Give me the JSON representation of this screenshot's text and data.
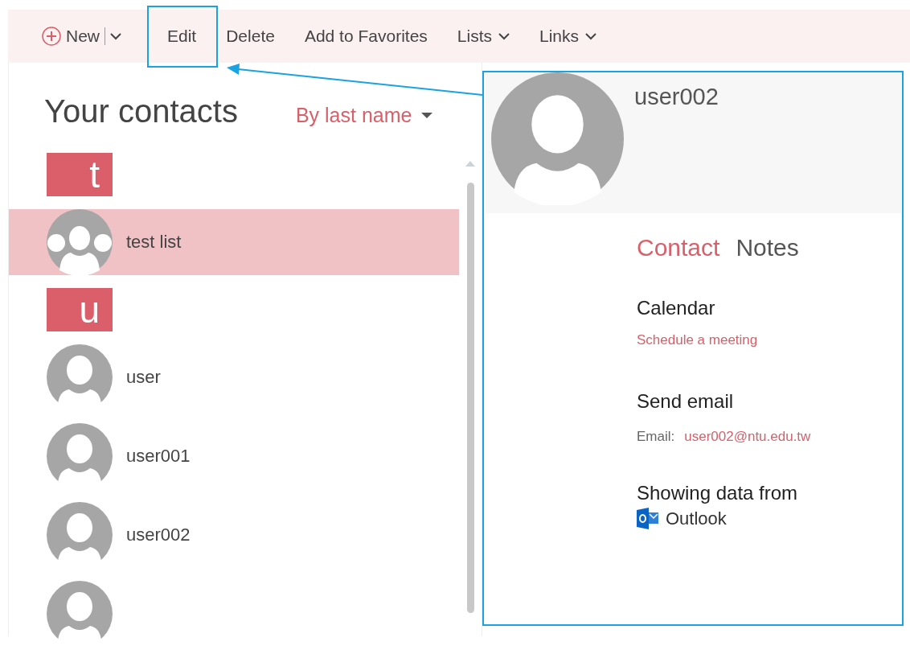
{
  "toolbar": {
    "items": [
      {
        "kind": "new",
        "label": "New"
      },
      {
        "kind": "plain",
        "label": "Edit"
      },
      {
        "kind": "plain",
        "label": "Delete"
      },
      {
        "kind": "plain",
        "label": "Add to Favorites"
      },
      {
        "kind": "menu",
        "label": "Lists"
      },
      {
        "kind": "menu",
        "label": "Links"
      }
    ]
  },
  "contacts": {
    "title": "Your contacts",
    "sort": "By last name",
    "items": [
      {
        "kind": "letter",
        "label": "t"
      },
      {
        "kind": "group",
        "name": "test list",
        "selected": true
      },
      {
        "kind": "letter",
        "label": "u"
      },
      {
        "kind": "person",
        "name": "user",
        "selected": false
      },
      {
        "kind": "person",
        "name": "user001",
        "selected": false
      },
      {
        "kind": "person",
        "name": "user002",
        "selected": false
      },
      {
        "kind": "person",
        "selected": false
      }
    ]
  },
  "details": {
    "name": "user002",
    "tabs": [
      {
        "label": "Contact",
        "selected": true
      },
      {
        "label": "Notes",
        "selected": false
      }
    ],
    "calendar": {
      "heading": "Calendar",
      "link": "Schedule a meeting"
    },
    "email": {
      "heading": "Send email",
      "label": "Email:",
      "address": "user002@ntu.edu.tw"
    },
    "source": {
      "heading": "Showing data from",
      "app": "Outlook"
    }
  }
}
